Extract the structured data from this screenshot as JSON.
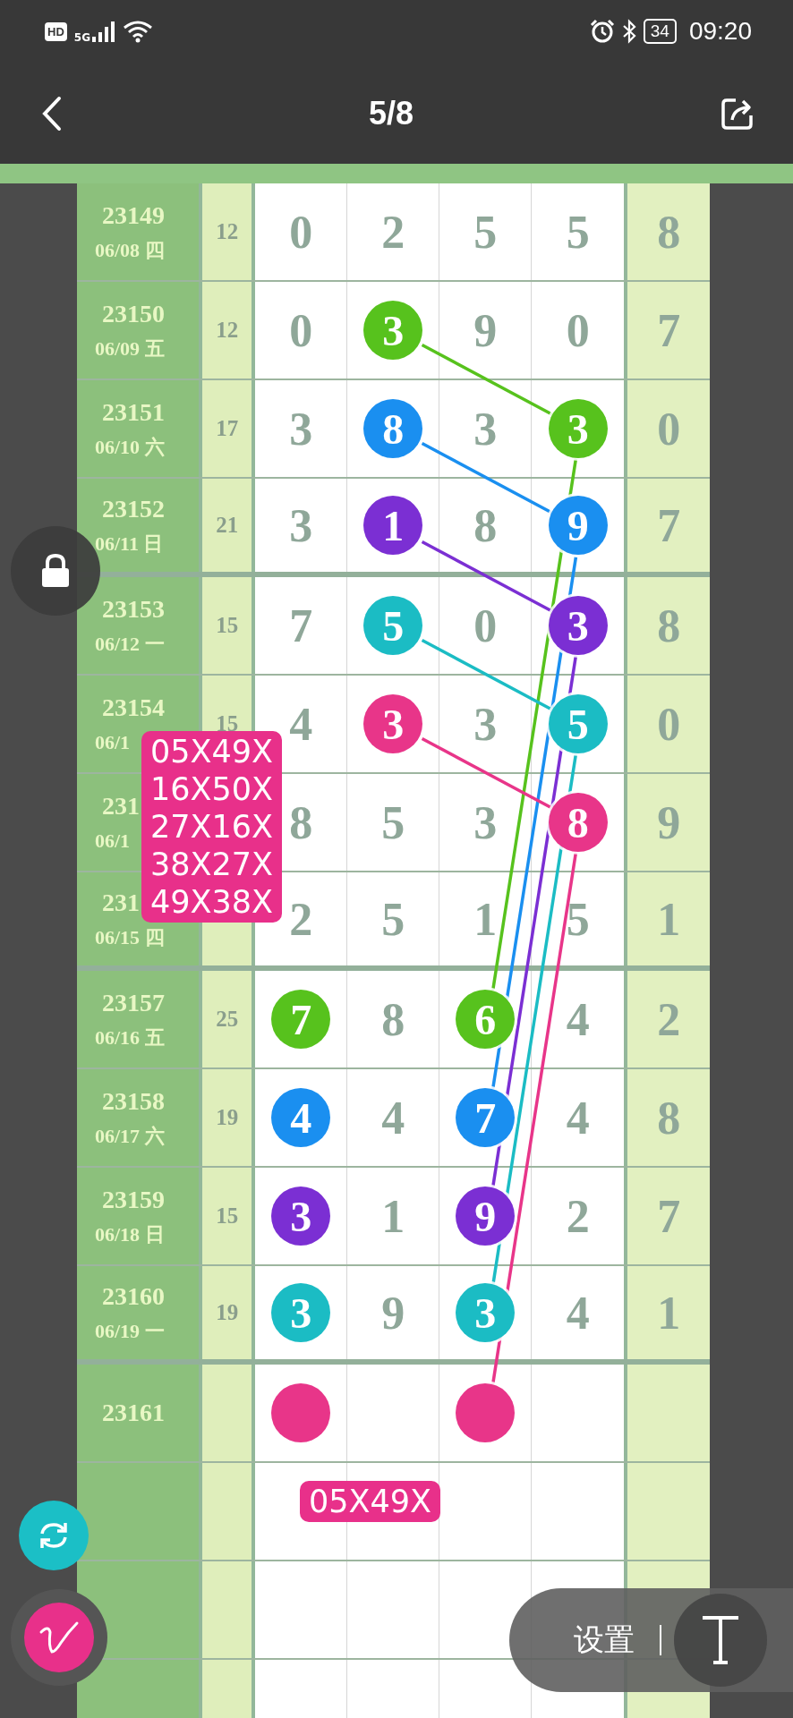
{
  "status_bar": {
    "hd": "HD",
    "network": "5G",
    "battery": "34",
    "time": "09:20"
  },
  "viewer": {
    "title": "5/8"
  },
  "chart": {
    "rows": [
      {
        "kind": "issue",
        "issue": "23149",
        "date": "06/08 四",
        "sum": "12",
        "digits": [
          {
            "kind": "digit",
            "value": "0"
          },
          {
            "kind": "digit",
            "value": "2"
          },
          {
            "kind": "digit",
            "value": "5"
          },
          {
            "kind": "digit",
            "value": "5"
          }
        ],
        "last": "8"
      },
      {
        "kind": "issue",
        "issue": "23150",
        "date": "06/09 五",
        "sum": "12",
        "digits": [
          {
            "kind": "digit",
            "value": "0"
          },
          {
            "kind": "ball",
            "value": "3",
            "color": "#57c21d",
            "linked": true
          },
          {
            "kind": "digit",
            "value": "9"
          },
          {
            "kind": "digit",
            "value": "0"
          }
        ],
        "last": "7"
      },
      {
        "kind": "issue",
        "issue": "23151",
        "date": "06/10 六",
        "sum": "17",
        "digits": [
          {
            "kind": "digit",
            "value": "3"
          },
          {
            "kind": "ball",
            "value": "8",
            "color": "#1a8ff0",
            "linked": true
          },
          {
            "kind": "digit",
            "value": "3"
          },
          {
            "kind": "ball",
            "value": "3",
            "color": "#57c21d",
            "linked": true
          }
        ],
        "last": "0"
      },
      {
        "kind": "issue",
        "issue": "23152",
        "date": "06/11 日",
        "sum": "21",
        "digits": [
          {
            "kind": "digit",
            "value": "3"
          },
          {
            "kind": "ball",
            "value": "1",
            "color": "#7b2fd3",
            "linked": true
          },
          {
            "kind": "digit",
            "value": "8"
          },
          {
            "kind": "ball",
            "value": "9",
            "color": "#1a8ff0",
            "linked": true
          }
        ],
        "last": "7"
      },
      {
        "kind": "issue",
        "issue": "23153",
        "date": "06/12 一",
        "sum": "15",
        "digits": [
          {
            "kind": "digit",
            "value": "7"
          },
          {
            "kind": "ball",
            "value": "5",
            "color": "#1bbcc4",
            "linked": true
          },
          {
            "kind": "digit",
            "value": "0"
          },
          {
            "kind": "ball",
            "value": "3",
            "color": "#7b2fd3",
            "linked": true
          }
        ],
        "last": "8"
      },
      {
        "kind": "issue",
        "issue": "23154",
        "date": "06/1",
        "sum": "15",
        "digits": [
          {
            "kind": "digit",
            "value": "4"
          },
          {
            "kind": "ball",
            "value": "3",
            "color": "#e83589",
            "linked": true
          },
          {
            "kind": "digit",
            "value": "3"
          },
          {
            "kind": "ball",
            "value": "5",
            "color": "#1bbcc4",
            "linked": true
          }
        ],
        "last": "0"
      },
      {
        "kind": "issue",
        "issue": "231",
        "date": "06/1",
        "digits": [
          {
            "kind": "digit",
            "value": "8"
          },
          {
            "kind": "digit",
            "value": "5"
          },
          {
            "kind": "digit",
            "value": "3"
          },
          {
            "kind": "ball",
            "value": "8",
            "color": "#e83589",
            "linked": true
          }
        ],
        "last": "9"
      },
      {
        "kind": "issue",
        "issue": "231",
        "date": "06/15 四",
        "digits": [
          {
            "kind": "digit",
            "value": "2"
          },
          {
            "kind": "digit",
            "value": "5"
          },
          {
            "kind": "digit",
            "value": "1"
          },
          {
            "kind": "digit",
            "value": "5"
          }
        ],
        "last": "1"
      },
      {
        "kind": "issue",
        "issue": "23157",
        "date": "06/16 五",
        "sum": "25",
        "digits": [
          {
            "kind": "ball",
            "value": "7",
            "color": "#57c21d"
          },
          {
            "kind": "digit",
            "value": "8"
          },
          {
            "kind": "ball",
            "value": "6",
            "color": "#57c21d",
            "linked": true
          },
          {
            "kind": "digit",
            "value": "4"
          }
        ],
        "last": "2"
      },
      {
        "kind": "issue",
        "issue": "23158",
        "date": "06/17 六",
        "sum": "19",
        "digits": [
          {
            "kind": "ball",
            "value": "4",
            "color": "#1a8ff0"
          },
          {
            "kind": "digit",
            "value": "4"
          },
          {
            "kind": "ball",
            "value": "7",
            "color": "#1a8ff0",
            "linked": true
          },
          {
            "kind": "digit",
            "value": "4"
          }
        ],
        "last": "8"
      },
      {
        "kind": "issue",
        "issue": "23159",
        "date": "06/18 日",
        "sum": "15",
        "digits": [
          {
            "kind": "ball",
            "value": "3",
            "color": "#7b2fd3"
          },
          {
            "kind": "digit",
            "value": "1"
          },
          {
            "kind": "ball",
            "value": "9",
            "color": "#7b2fd3",
            "linked": true
          },
          {
            "kind": "digit",
            "value": "2"
          }
        ],
        "last": "7"
      },
      {
        "kind": "issue",
        "issue": "23160",
        "date": "06/19 一",
        "sum": "19",
        "digits": [
          {
            "kind": "ball",
            "value": "3",
            "color": "#1bbcc4"
          },
          {
            "kind": "digit",
            "value": "9"
          },
          {
            "kind": "ball",
            "value": "3",
            "color": "#1bbcc4",
            "linked": true
          },
          {
            "kind": "digit",
            "value": "4"
          }
        ],
        "last": "1"
      },
      {
        "kind": "issue",
        "issue": "23161",
        "digits": [
          {
            "kind": "ball",
            "color": "#e83589"
          },
          {
            "kind": "blank"
          },
          {
            "kind": "ball",
            "color": "#e83589",
            "linked": true
          },
          {
            "kind": "blank"
          }
        ]
      },
      {
        "kind": "blank"
      },
      {
        "kind": "blank"
      },
      {
        "kind": "blank"
      }
    ]
  },
  "callouts": [
    {
      "lines": [
        "05X49X",
        "16X50X",
        "27X16X",
        "38X27X",
        "49X38X"
      ]
    },
    {
      "lines": [
        "05X49X"
      ]
    }
  ],
  "toolbar": {
    "label": "设置"
  }
}
